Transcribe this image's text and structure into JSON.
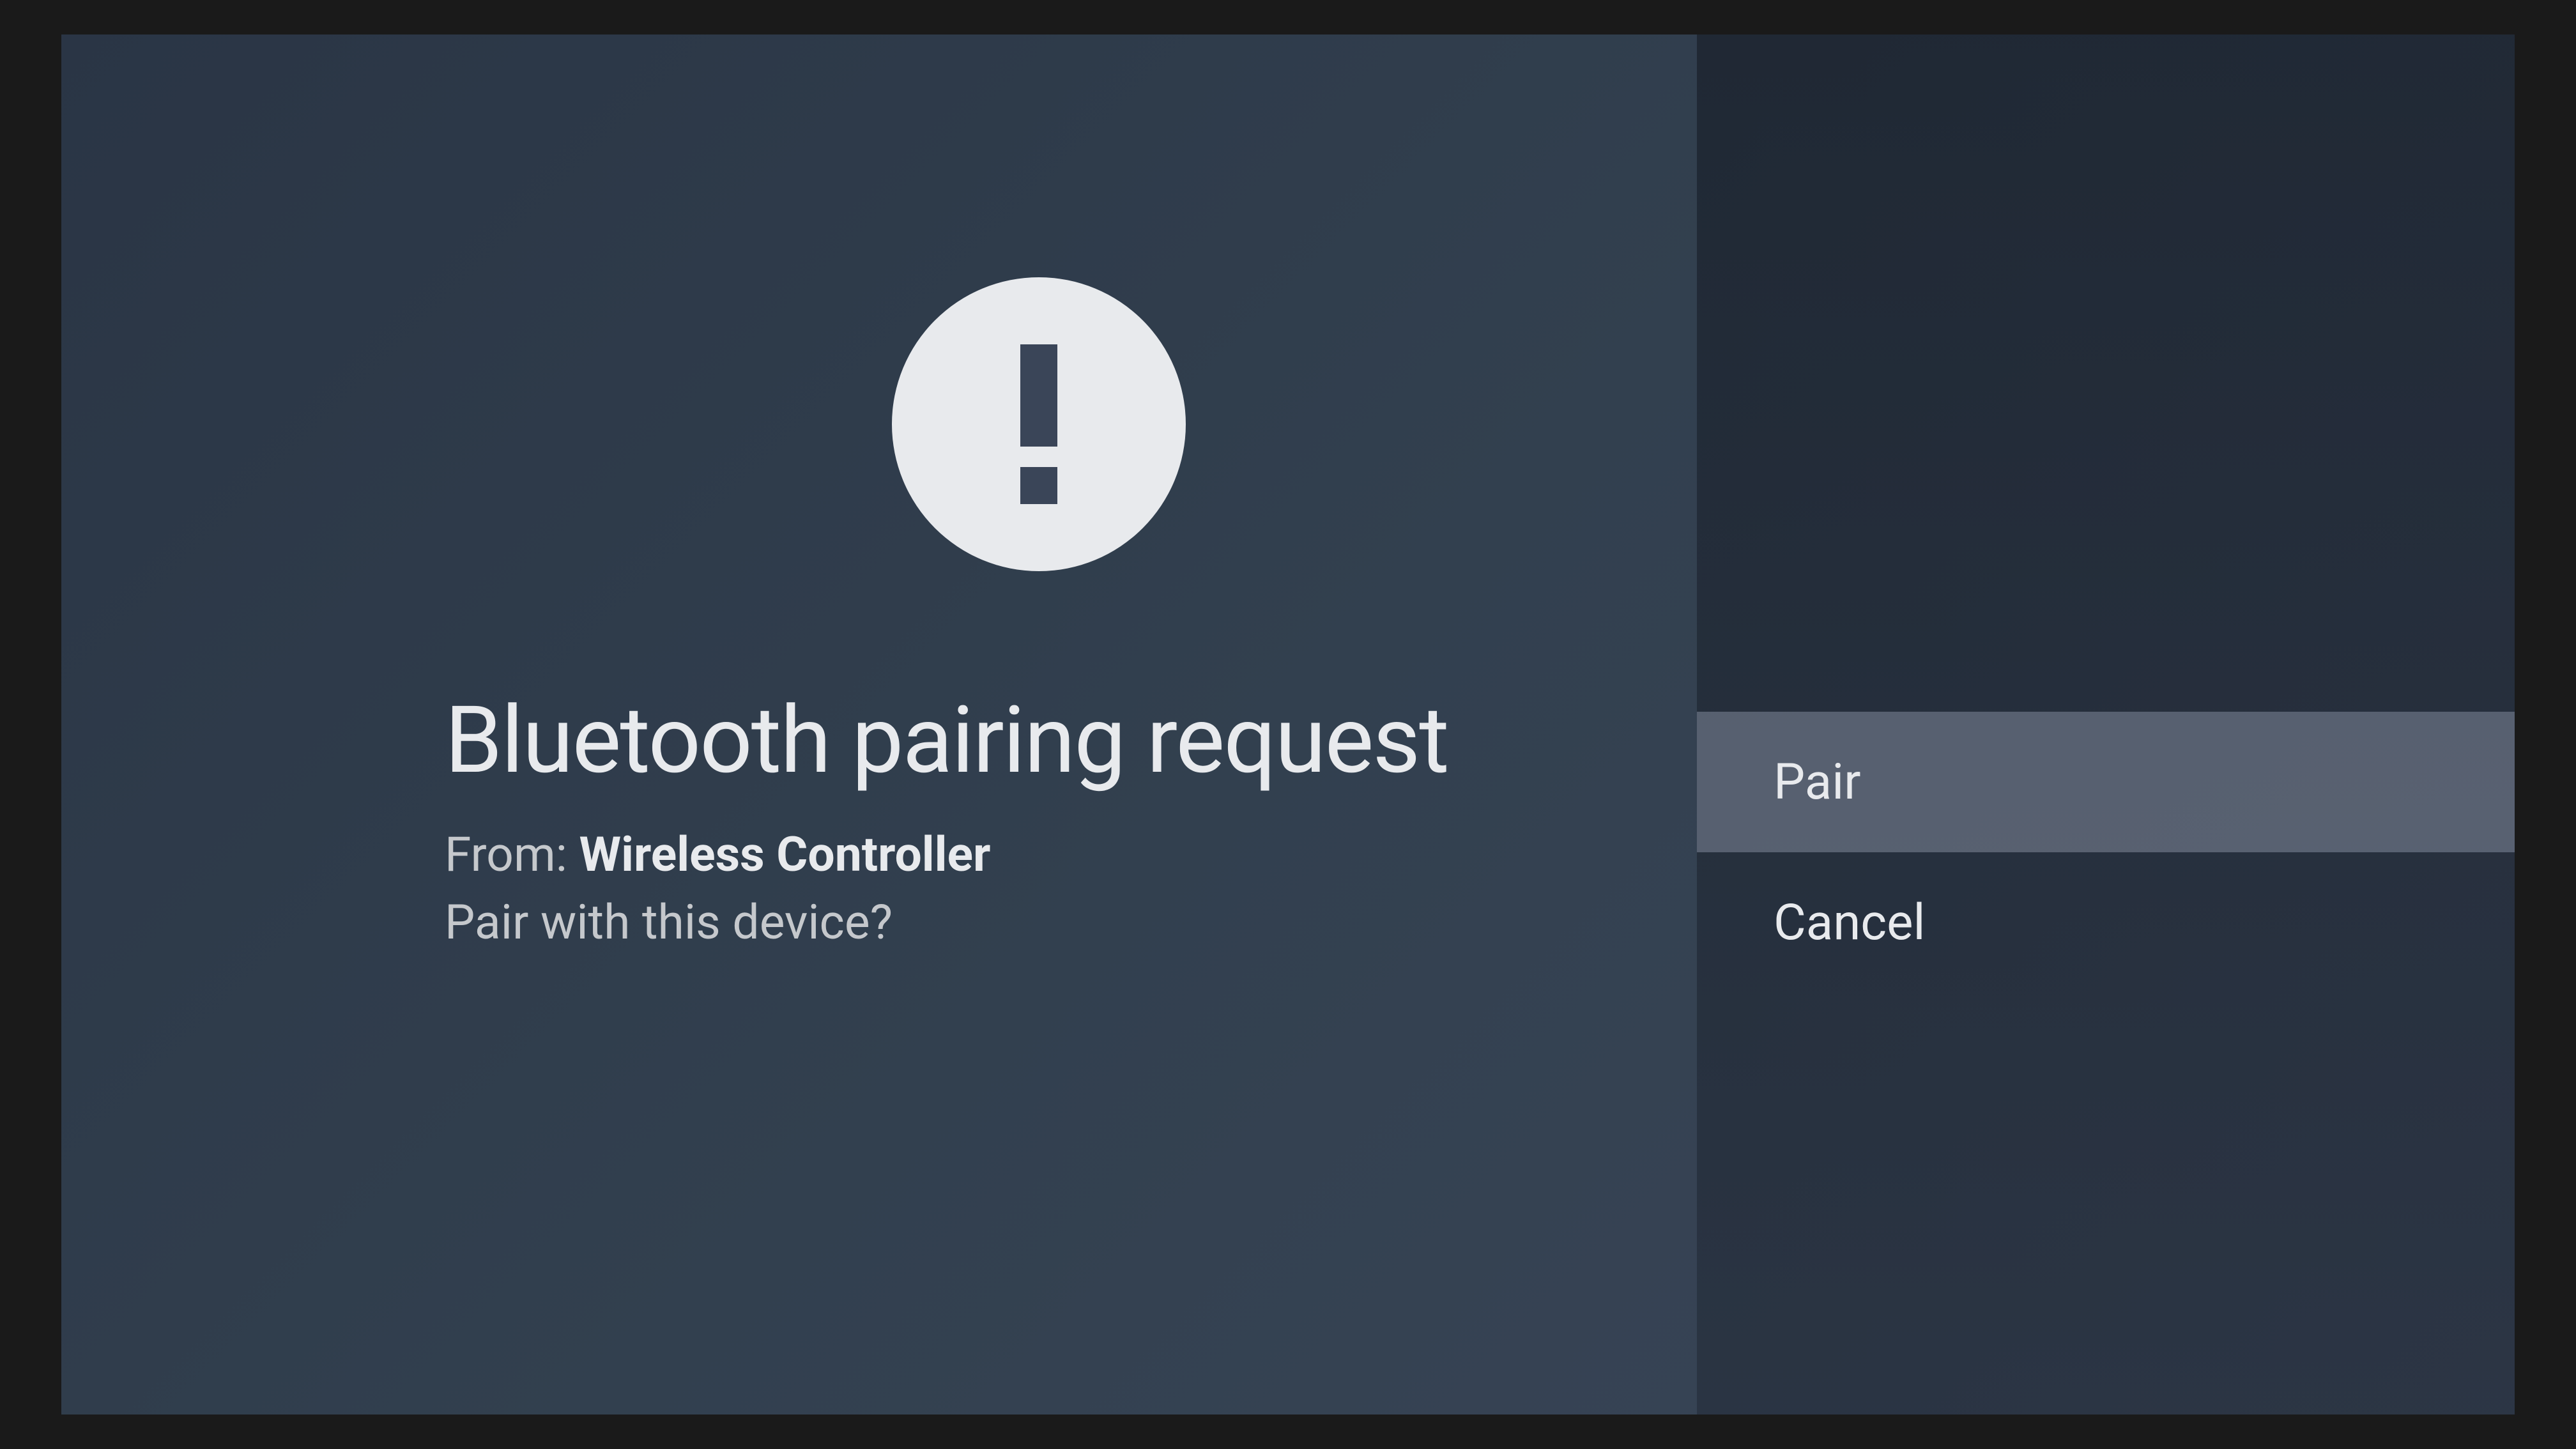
{
  "dialog": {
    "title": "Bluetooth pairing request",
    "from_label": "From:",
    "device_name": "Wireless Controller",
    "question": "Pair with this device?"
  },
  "options": {
    "pair": "Pair",
    "cancel": "Cancel"
  }
}
